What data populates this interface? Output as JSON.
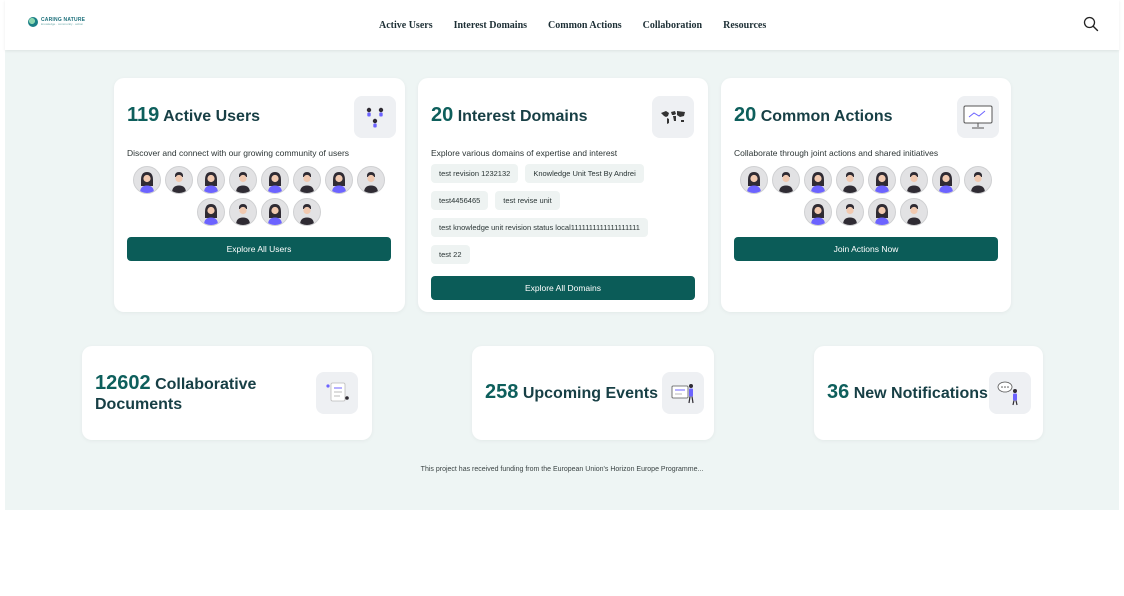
{
  "header": {
    "logo_title": "CARING NATURE",
    "logo_subtitle": "knowledge · community · action",
    "nav": [
      "Active Users",
      "Interest Domains",
      "Common Actions",
      "Collaboration",
      "Resources"
    ]
  },
  "cards": {
    "users": {
      "count": "119",
      "title": "Active Users",
      "description": "Discover and connect with our growing community of users",
      "button": "Explore All Users",
      "avatar_genders": [
        "f",
        "m",
        "f",
        "m",
        "f",
        "m",
        "f",
        "m",
        "f",
        "m",
        "f",
        "m"
      ]
    },
    "domains": {
      "count": "20",
      "title": "Interest Domains",
      "description": "Explore various domains of expertise and interest",
      "tags": [
        "test revision 1232132",
        "Knowledge Unit Test By Andrei",
        "test4456465",
        "test revise unit",
        "test knowledge unit revision status local1111111111111111111",
        "test 22"
      ],
      "button": "Explore All Domains"
    },
    "actions": {
      "count": "20",
      "title": "Common Actions",
      "description": "Collaborate through joint actions and shared initiatives",
      "button": "Join Actions Now",
      "avatar_genders": [
        "f",
        "m",
        "f",
        "m",
        "f",
        "m",
        "f",
        "m",
        "f",
        "m",
        "f",
        "m"
      ]
    }
  },
  "stats": {
    "documents": {
      "count": "12602",
      "label_line1": "Collaborative",
      "label_line2": "Documents"
    },
    "events": {
      "count": "258",
      "label": "Upcoming Events"
    },
    "notifications": {
      "count": "36",
      "label": "New Notifications"
    }
  },
  "footer": {
    "text": "This project has received funding from the European Union's Horizon Europe Programme..."
  },
  "colors": {
    "accent": "#0b5c58",
    "heading_number": "#0e5f5c",
    "background": "#eef5f4",
    "avatar_hair": "#2f2b33",
    "avatar_shirt": "#6c63ff"
  }
}
